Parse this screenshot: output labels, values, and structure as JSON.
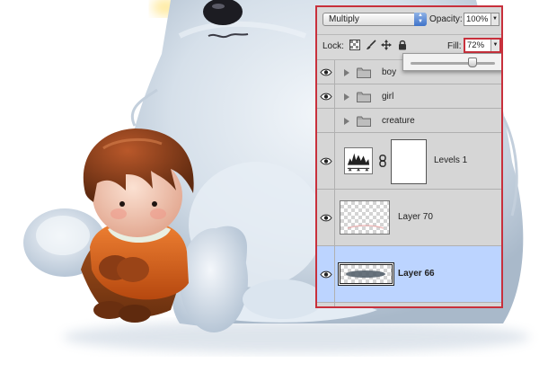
{
  "panel": {
    "blend_mode": "Multiply",
    "opacity_label": "Opacity:",
    "opacity_value": "100%",
    "lock_label": "Lock:",
    "fill_label": "Fill:",
    "fill_value": "72%",
    "fill_slider_fraction": 0.72
  },
  "layers": [
    {
      "name": "boy",
      "kind": "group"
    },
    {
      "name": "girl",
      "kind": "group"
    },
    {
      "name": "creature",
      "kind": "group"
    },
    {
      "name": "Levels 1",
      "kind": "adjustment"
    },
    {
      "name": "Layer 70",
      "kind": "pixel"
    },
    {
      "name": "Layer 66",
      "kind": "pixel",
      "selected": true
    },
    {
      "name": "",
      "kind": "pixel"
    }
  ],
  "colors": {
    "highlight_red": "#c8303c",
    "selected_row": "#bcd4ff",
    "panel_bg": "#d6d6d6",
    "boy_shirt": "#e0661a",
    "boy_hair": "#7a3312",
    "creature_fur": "#dbe5ef"
  },
  "icons": {
    "blend_arrows": "updown-arrows-icon",
    "dropdown": "triangle-down-icon",
    "visibility": "eye-icon",
    "group": "folder-icon",
    "expand": "triangle-right-icon",
    "link": "chain-link-icon",
    "lock_transparent": "checker-lock-icon",
    "lock_image": "brush-icon",
    "lock_position": "move-icon",
    "lock_all": "padlock-icon"
  }
}
